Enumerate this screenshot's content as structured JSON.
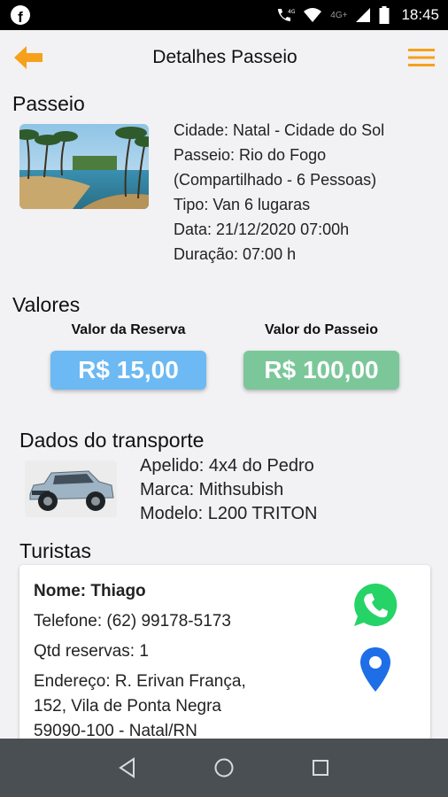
{
  "status_bar": {
    "time": "18:45",
    "network_1": "4G",
    "network_2": "4G+",
    "icons": [
      "facebook-icon",
      "phone-wifi-icon",
      "wifi-icon",
      "signal-icon",
      "battery-icon"
    ]
  },
  "header": {
    "title": "Detalhes Passeio",
    "back_icon": "arrow-left-icon",
    "menu_icon": "hamburger-menu-icon"
  },
  "passeio": {
    "section_title": "Passeio",
    "cidade": "Cidade: Natal - Cidade do Sol",
    "passeio": "Passeio: Rio do Fogo",
    "compartilhado": "(Compartilhado - 6 Pessoas)",
    "tipo": "Tipo: Van 6 lugaras",
    "data": "Data: 21/12/2020 07:00h",
    "duracao": "Duração: 07:00 h"
  },
  "valores": {
    "section_title": "Valores",
    "reserva_label": "Valor da Reserva",
    "reserva_value": "R$ 15,00",
    "passeio_label": "Valor do Passeio",
    "passeio_value": "R$ 100,00"
  },
  "transporte": {
    "section_title": "Dados do transporte",
    "apelido": "Apelido: 4x4 do Pedro",
    "marca": "Marca: Mithsubish",
    "modelo": "Modelo: L200 TRITON"
  },
  "turistas": {
    "section_title": "Turistas",
    "items": [
      {
        "nome": "Nome: Thiago",
        "telefone": "Telefone: (62) 99178-5173",
        "qtd": "Qtd reservas: 1",
        "endereco_1": "Endereço: R. Erivan França,",
        "endereco_2": "152, Vila de Ponta Negra",
        "endereco_3": "59090-100 - Natal/RN"
      }
    ]
  },
  "colors": {
    "accent": "#f5a11b",
    "reserva_pill": "#6cb9f3",
    "passeio_pill": "#7cc79a",
    "whatsapp": "#25d366",
    "location": "#1e6ee8",
    "navbar": "#4a4f54"
  }
}
